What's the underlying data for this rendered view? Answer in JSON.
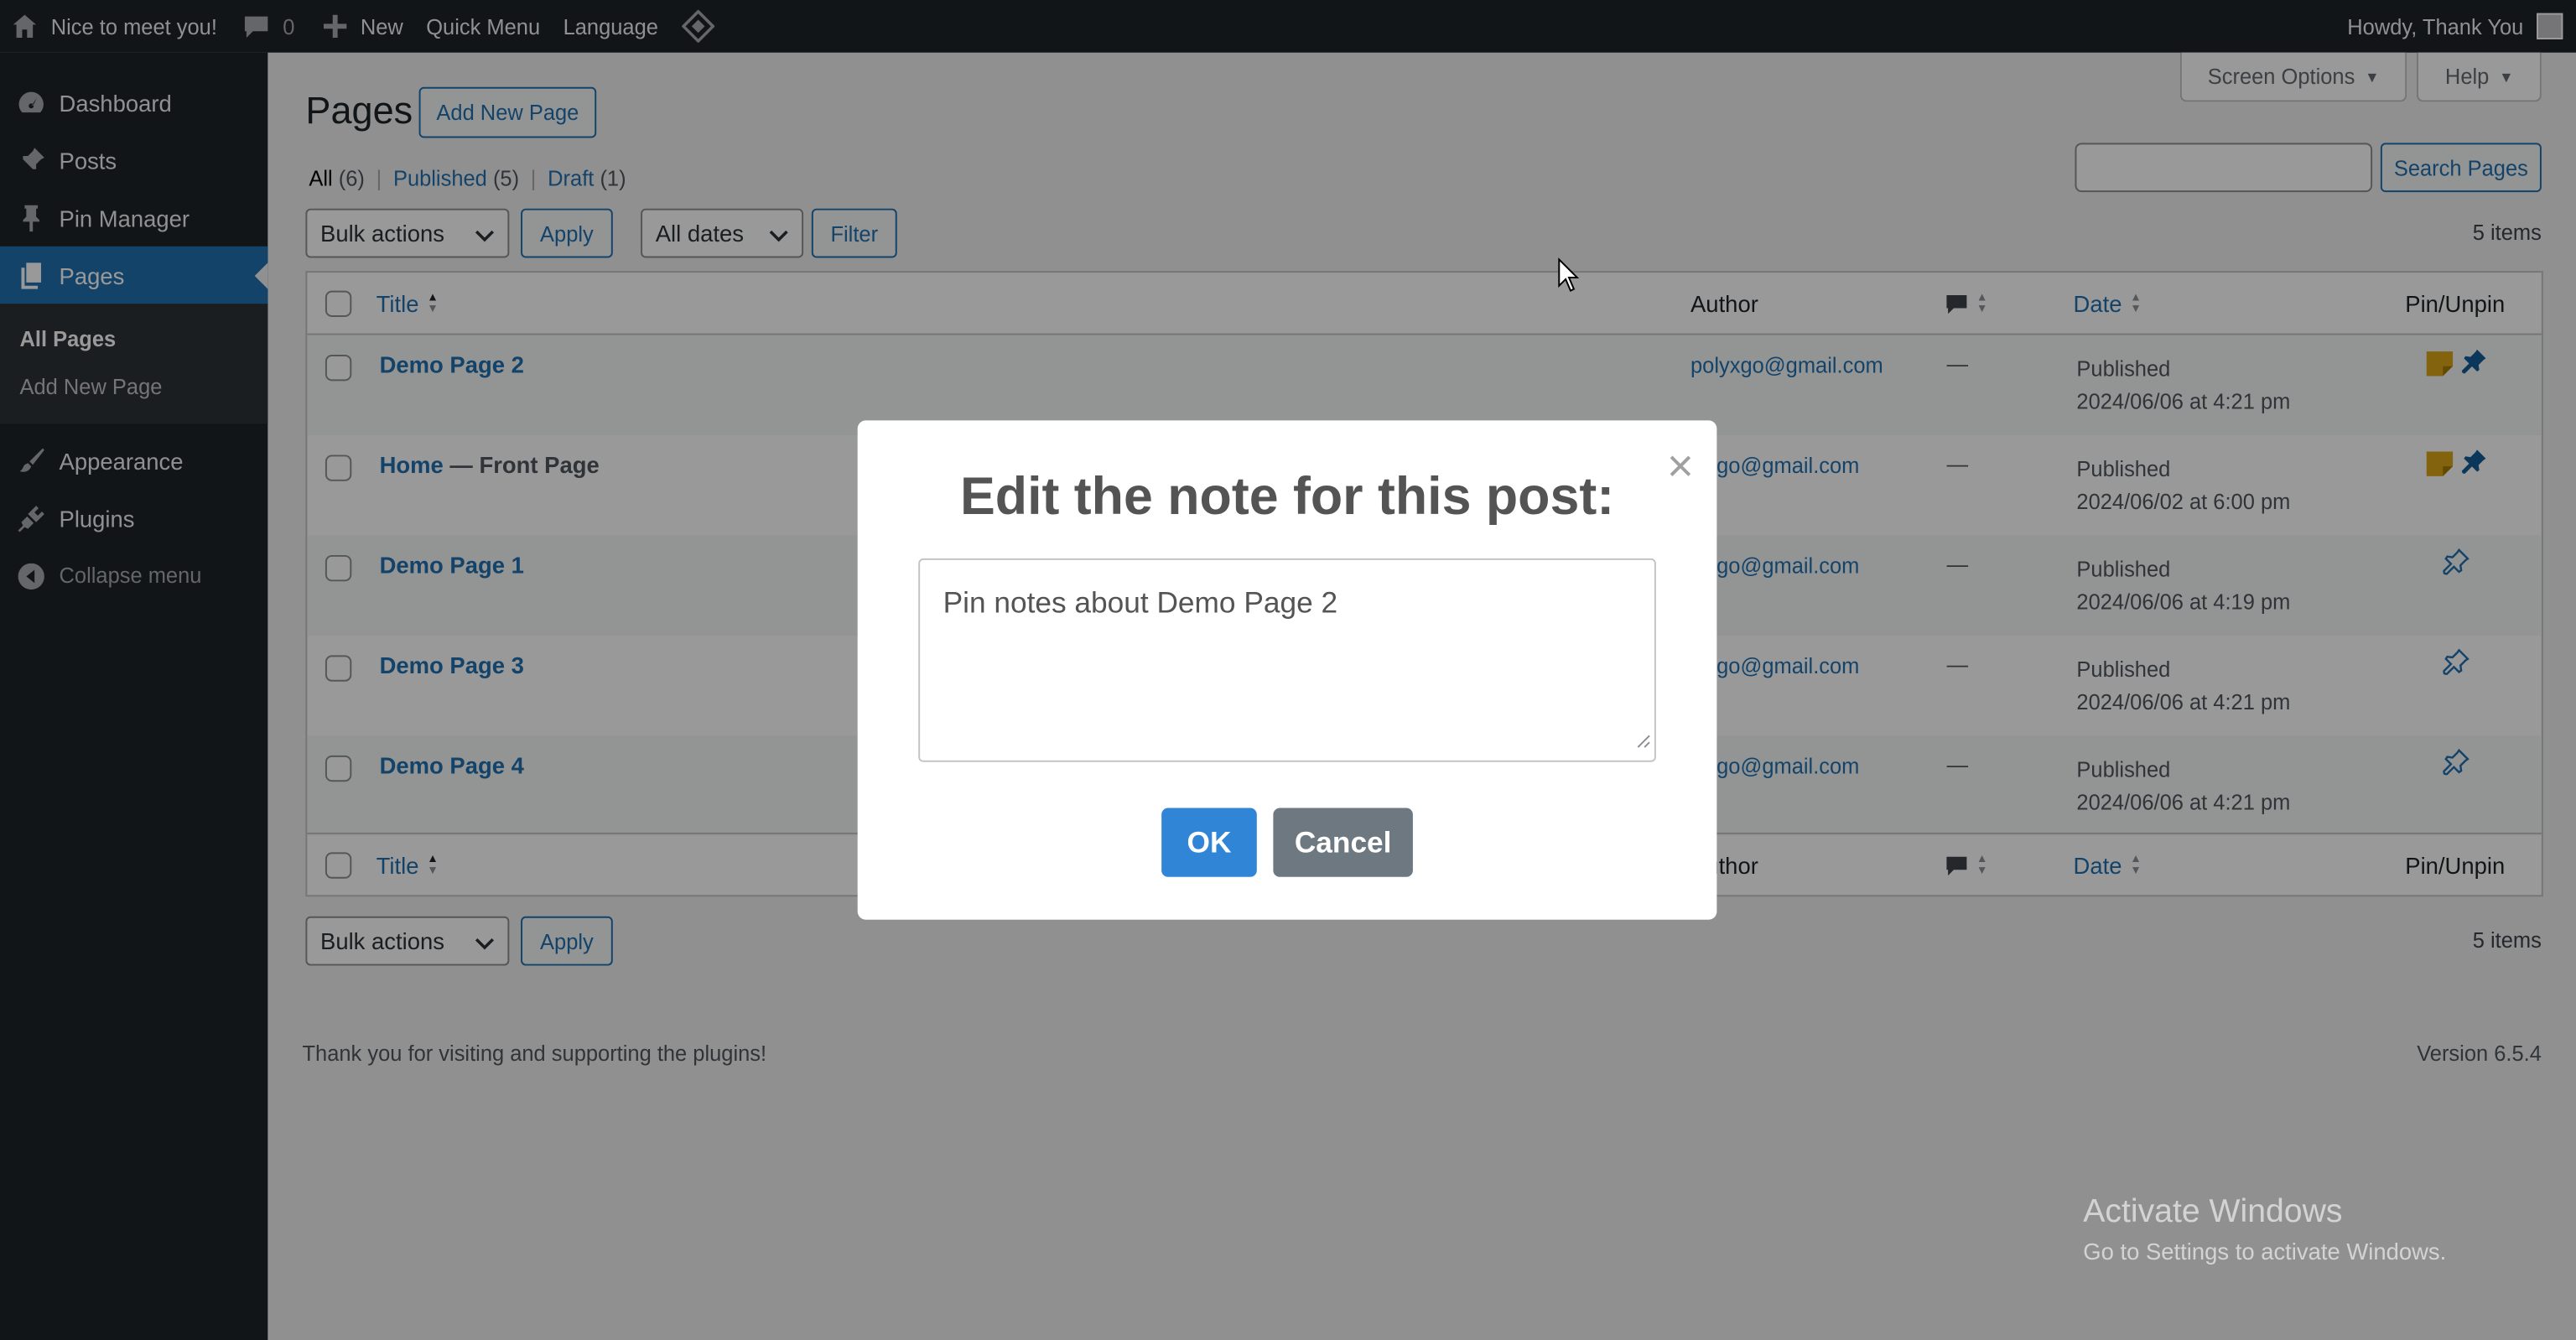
{
  "adminbar": {
    "site_name": "Nice to meet you!",
    "comments_count": "0",
    "new_label": "New",
    "quick_menu": "Quick Menu",
    "language": "Language",
    "howdy": "Howdy, Thank You"
  },
  "sidebar": {
    "items": [
      {
        "label": "Dashboard",
        "icon": "dashboard-icon"
      },
      {
        "label": "Posts",
        "icon": "pushpin-icon"
      },
      {
        "label": "Pin Manager",
        "icon": "pin-icon"
      },
      {
        "label": "Pages",
        "icon": "pages-icon"
      },
      {
        "label": "Appearance",
        "icon": "paintbrush-icon"
      },
      {
        "label": "Plugins",
        "icon": "plugin-icon"
      }
    ],
    "submenu": [
      "All Pages",
      "Add New Page"
    ],
    "collapse": "Collapse menu"
  },
  "screen_meta": {
    "screen_options": "Screen Options",
    "help": "Help"
  },
  "page": {
    "title": "Pages",
    "add_new": "Add New Page",
    "filters": {
      "all": "All",
      "all_count": "(6)",
      "published": "Published",
      "published_count": "(5)",
      "draft": "Draft",
      "draft_count": "(1)"
    },
    "bulk_actions": "Bulk actions",
    "apply": "Apply",
    "all_dates": "All dates",
    "filter": "Filter",
    "search_button": "Search Pages",
    "items_count": "5 items"
  },
  "table": {
    "columns": {
      "title": "Title",
      "author": "Author",
      "date": "Date",
      "pin": "Pin/Unpin"
    },
    "footer_author": "thor",
    "rows": [
      {
        "title": "Demo Page 2",
        "suffix": "",
        "author": "polyxgo@gmail.com",
        "comments": "—",
        "status": "Published",
        "date": "2024/06/06 at 4:21 pm",
        "pinned": true
      },
      {
        "title": "Home",
        "suffix": " — Front Page",
        "author": "lyxgo@gmail.com",
        "comments": "—",
        "status": "Published",
        "date": "2024/06/02 at 6:00 pm",
        "pinned": true
      },
      {
        "title": "Demo Page 1",
        "suffix": "",
        "author": "lyxgo@gmail.com",
        "comments": "—",
        "status": "Published",
        "date": "2024/06/06 at 4:19 pm",
        "pinned": false
      },
      {
        "title": "Demo Page 3",
        "suffix": "",
        "author": "lyxgo@gmail.com",
        "comments": "—",
        "status": "Published",
        "date": "2024/06/06 at 4:21 pm",
        "pinned": false
      },
      {
        "title": "Demo Page 4",
        "suffix": "",
        "author": "lyxgo@gmail.com",
        "comments": "—",
        "status": "Published",
        "date": "2024/06/06 at 4:21 pm",
        "pinned": false
      }
    ]
  },
  "footer": {
    "thanks": "Thank you for visiting and supporting the plugins!",
    "version": "Version 6.5.4"
  },
  "watermark": {
    "line1": "Activate Windows",
    "line2": "Go to Settings to activate Windows."
  },
  "modal": {
    "title": "Edit the note for this post:",
    "note_value": "Pin notes about Demo Page 2",
    "ok": "OK",
    "cancel": "Cancel",
    "close": "×"
  },
  "colors": {
    "accent": "#2271b1",
    "ok_button": "#3085d6",
    "cancel_button": "#6e7881",
    "note_icon": "#dba617"
  }
}
